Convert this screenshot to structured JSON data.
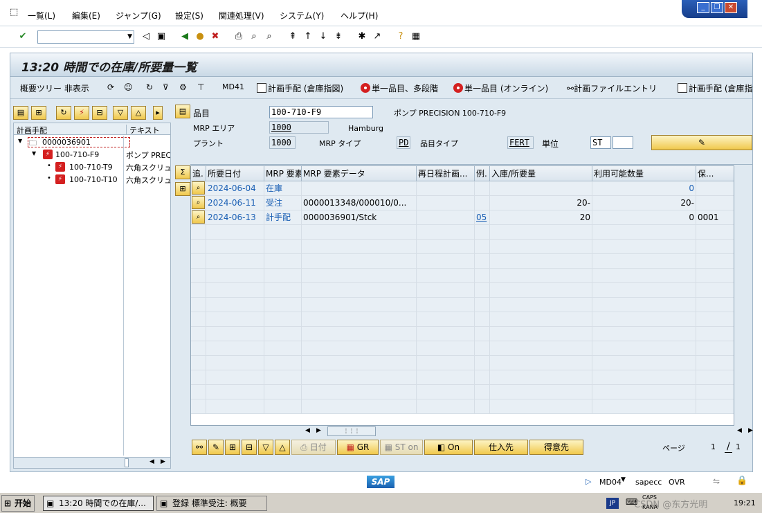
{
  "menu": {
    "items": [
      "一覧(L)",
      "編集(E)",
      "ジャンプ(G)",
      "設定(S)",
      "関連処理(V)",
      "システム(Y)",
      "ヘルプ(H)"
    ]
  },
  "window_controls": {
    "minimize": "_",
    "restore": "❐",
    "close": "✕"
  },
  "title": "13:20 時間での在庫/所要量一覧",
  "app_toolbar": {
    "tree_toggle": "概要ツリー 非表示",
    "md41": "MD41",
    "plan_order_storage": "計画手配 (倉庫指図)",
    "single_item_multi": "単一品目、多段階",
    "single_item_online": "単一品目 (オンライン)",
    "plan_file_entry": "計画ファイルエントリ",
    "plan_order_storage2": "計画手配 (倉庫指"
  },
  "tree": {
    "col1": "計画手配",
    "col2": "テキスト",
    "rows": [
      {
        "label": "0000036901",
        "text": ""
      },
      {
        "label": "100-710-F9",
        "text": "ポンプ PREC"
      },
      {
        "label": "100-710-T9",
        "text": "六角スクリュ"
      },
      {
        "label": "100-710-T10",
        "text": "六角スクリュ"
      }
    ]
  },
  "header": {
    "material_label": "品目",
    "material_value": "100-710-F9",
    "material_desc": "ポンプ PRECISION 100-710-F9",
    "mrp_area_label": "MRP エリア",
    "mrp_area_value": "1000",
    "mrp_area_desc": "Hamburg",
    "plant_label": "プラント",
    "plant_value": "1000",
    "mrp_type_label": "MRP タイプ",
    "mrp_type_value": "PD",
    "mat_type_label": "品目タイプ",
    "mat_type_value": "FERT",
    "unit_label": "単位",
    "unit_value": "ST"
  },
  "grid": {
    "columns": [
      "追.",
      "所要日付",
      "MRP 要素",
      "MRP 要素データ",
      "再日程計画...",
      "例.",
      "入庫/所要量",
      "利用可能数量",
      "保..."
    ],
    "rows": [
      {
        "date": "2024-06-04",
        "element": "在庫",
        "data": "",
        "resched": "",
        "exc": "",
        "qty": "",
        "avail": "0",
        "stor": ""
      },
      {
        "date": "2024-06-11",
        "element": "受注",
        "data": "0000013348/000010/0...",
        "resched": "",
        "exc": "",
        "qty": "20-",
        "avail": "20-",
        "stor": ""
      },
      {
        "date": "2024-06-13",
        "element": "計手配",
        "data": "0000036901/Stck",
        "resched": "",
        "exc": "05",
        "qty": "20",
        "avail": "0",
        "stor": "0001"
      }
    ]
  },
  "bottom_buttons": {
    "date": "日付",
    "gr": "GR",
    "st_on": "ST on",
    "on": "On",
    "vendor": "仕入先",
    "customer": "得意先"
  },
  "paging": {
    "label": "ページ",
    "current": "1",
    "sep": "/",
    "total": "1"
  },
  "status": {
    "tcode": "MD04",
    "server": "sapecc",
    "mode": "OVR",
    "logo": "SAP"
  },
  "taskbar": {
    "start": "开始",
    "task1": "13:20 時間での在庫/...",
    "task2": "登録 標準受注: 概要",
    "lang": "JP",
    "caps": "CAPS",
    "kana": "KANA",
    "watermark": "CSDN @东方光明",
    "clock": "19:21"
  }
}
